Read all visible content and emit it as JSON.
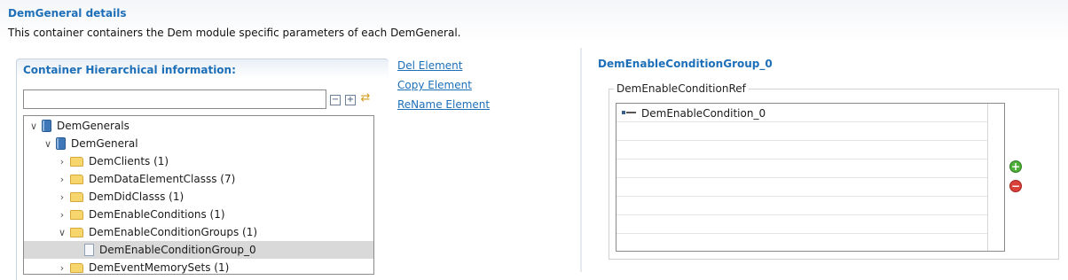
{
  "page": {
    "title": "DemGeneral details",
    "description": "This container containers the Dem module specific parameters of each DemGeneral."
  },
  "left_panel": {
    "title": "Container Hierarchical information:",
    "filter_value": "",
    "tree": [
      {
        "label": "DemGenerals",
        "expanded": true,
        "icon": "container-icon"
      },
      {
        "label": "DemGeneral",
        "expanded": true,
        "icon": "container-icon"
      },
      {
        "label": "DemClients (1)",
        "expanded": false,
        "icon": "folder-icon"
      },
      {
        "label": "DemDataElementClasss (7)",
        "expanded": false,
        "icon": "folder-icon"
      },
      {
        "label": "DemDidClasss (1)",
        "expanded": false,
        "icon": "folder-icon"
      },
      {
        "label": "DemEnableConditions (1)",
        "expanded": false,
        "icon": "folder-icon"
      },
      {
        "label": "DemEnableConditionGroups (1)",
        "expanded": true,
        "icon": "folder-icon"
      },
      {
        "label": "DemEnableConditionGroup_0",
        "selected": true,
        "icon": "file-icon"
      },
      {
        "label": "DemEventMemorySets (1)",
        "expanded": false,
        "icon": "folder-icon"
      }
    ]
  },
  "actions": {
    "delete": "Del Element",
    "copy": "Copy Element",
    "rename": "ReName Element"
  },
  "right_panel": {
    "title": "DemEnableConditionGroup_0",
    "group_label": "DemEnableConditionRef",
    "items": [
      "DemEnableCondition_0"
    ],
    "add_label": "+",
    "remove_label": "−"
  },
  "colors": {
    "link": "#1d6fb8",
    "selection": "#d9d9d9",
    "add": "#4fae3a",
    "remove": "#d9403a"
  }
}
